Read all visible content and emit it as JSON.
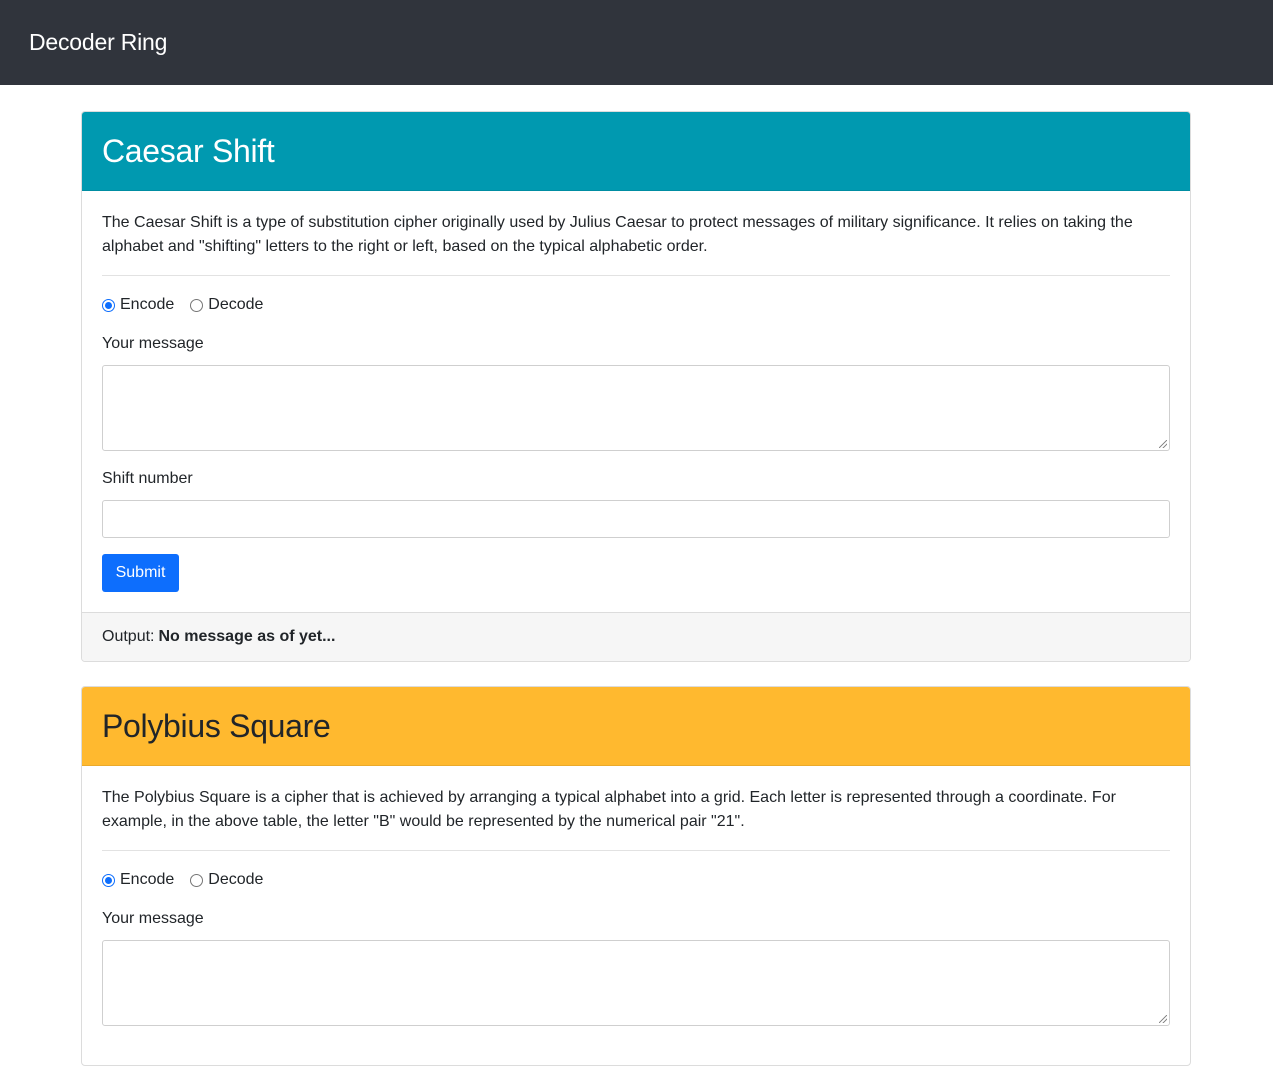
{
  "navbar": {
    "brand": "Decoder Ring"
  },
  "caesar": {
    "title": "Caesar Shift",
    "description": "The Caesar Shift is a type of substitution cipher originally used by Julius Caesar to protect messages of military significance. It relies on taking the alphabet and \"shifting\" letters to the right or left, based on the typical alphabetic order.",
    "mode_options": [
      "Encode",
      "Decode"
    ],
    "selected_mode": "Encode",
    "message_label": "Your message",
    "message_value": "",
    "shift_label": "Shift number",
    "shift_value": "",
    "submit_label": "Submit",
    "output_label": "Output:",
    "output_value": "No message as of yet..."
  },
  "polybius": {
    "title": "Polybius Square",
    "description": "The Polybius Square is a cipher that is achieved by arranging a typical alphabet into a grid. Each letter is represented through a coordinate. For example, in the above table, the letter \"B\" would be represented by the numerical pair \"21\".",
    "mode_options": [
      "Encode",
      "Decode"
    ],
    "selected_mode": "Encode",
    "message_label": "Your message",
    "message_value": ""
  },
  "colors": {
    "navbar": "#30343c",
    "caesar_header": "#0099b0",
    "polybius_header": "#ffb92f",
    "primary": "#0d6efd"
  }
}
